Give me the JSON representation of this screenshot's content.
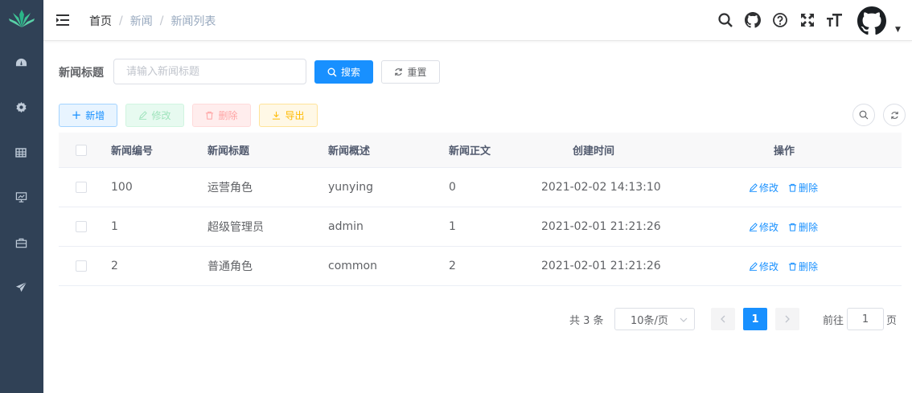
{
  "breadcrumb": [
    "首页",
    "新闻",
    "新闻列表"
  ],
  "search": {
    "label": "新闻标题",
    "placeholder": "请输入新闻标题",
    "search_label": "搜索",
    "reset_label": "重置"
  },
  "toolbar": {
    "add_label": "新增",
    "edit_label": "修改",
    "delete_label": "删除",
    "export_label": "导出"
  },
  "table": {
    "columns": [
      "新闻编号",
      "新闻标题",
      "新闻概述",
      "新闻正文",
      "创建时间",
      "操作"
    ],
    "rows": [
      {
        "id": "100",
        "title": "运营角色",
        "summary": "yunying",
        "content": "0",
        "created": "2021-02-02 14:13:10"
      },
      {
        "id": "1",
        "title": "超级管理员",
        "summary": "admin",
        "content": "1",
        "created": "2021-02-01 21:21:26"
      },
      {
        "id": "2",
        "title": "普通角色",
        "summary": "common",
        "content": "2",
        "created": "2021-02-01 21:21:26"
      }
    ],
    "row_edit": "修改",
    "row_delete": "删除"
  },
  "pagination": {
    "total_text": "共 3 条",
    "page_size": "10条/页",
    "current_page": "1",
    "goto_label": "前往",
    "goto_value": "1",
    "page_suffix": "页"
  },
  "colors": {
    "sidebar": "#304156",
    "primary": "#1890ff"
  }
}
